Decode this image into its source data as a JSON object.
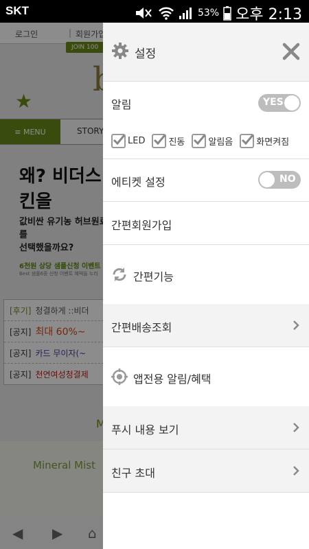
{
  "status_bar": {
    "carrier": "SKT",
    "battery_percent": "53%",
    "time": "오후 2:13"
  },
  "background_page": {
    "login": "로그인",
    "signup": "회원가입",
    "join_badge": "JOIN 100",
    "logo": "b",
    "menu_label": "≡ MENU",
    "story_label": "STORY",
    "promo_title": "왜? 비더스킨을",
    "promo_line1": "값비싼 유기농 허브원료를",
    "promo_line2": "선택했을까요?",
    "promo_event": "6천원 상당 샘플신청 이벤트",
    "promo_small": "Best 샘플6종 신청 이벤트 혜택을 누리",
    "notices": [
      {
        "tag": "[후기]",
        "text": "청결하게 ::비더",
        "color": "#555555"
      },
      {
        "tag": "[공지]",
        "text": "최대 60%~",
        "color": "#d04a1a"
      },
      {
        "tag": "[공지]",
        "text": "카드 무이자(~",
        "color": "#4a3a9a"
      },
      {
        "tag": "[공지]",
        "text": "천연여성청결제",
        "color": "#c0201a"
      }
    ],
    "mineral_title": "Mineral Mist",
    "mineral_tag": "M"
  },
  "drawer": {
    "title": "설정",
    "alarm": {
      "label": "알림",
      "toggle": "YES",
      "on": true
    },
    "checkboxes": [
      {
        "label": "LED",
        "checked": true
      },
      {
        "label": "진동",
        "checked": true
      },
      {
        "label": "알림음",
        "checked": true
      },
      {
        "label": "화면켜짐",
        "checked": true
      }
    ],
    "etiquette": {
      "label": "에티켓 설정",
      "toggle": "NO",
      "on": false
    },
    "easy_signup": "간편회원가입",
    "easy_functions": "간편기능",
    "delivery_lookup": "간편배송조회",
    "app_alarm": "앱전용 알림/혜택",
    "push_view": "푸시 내용 보기",
    "invite_friends": "친구 초대"
  }
}
